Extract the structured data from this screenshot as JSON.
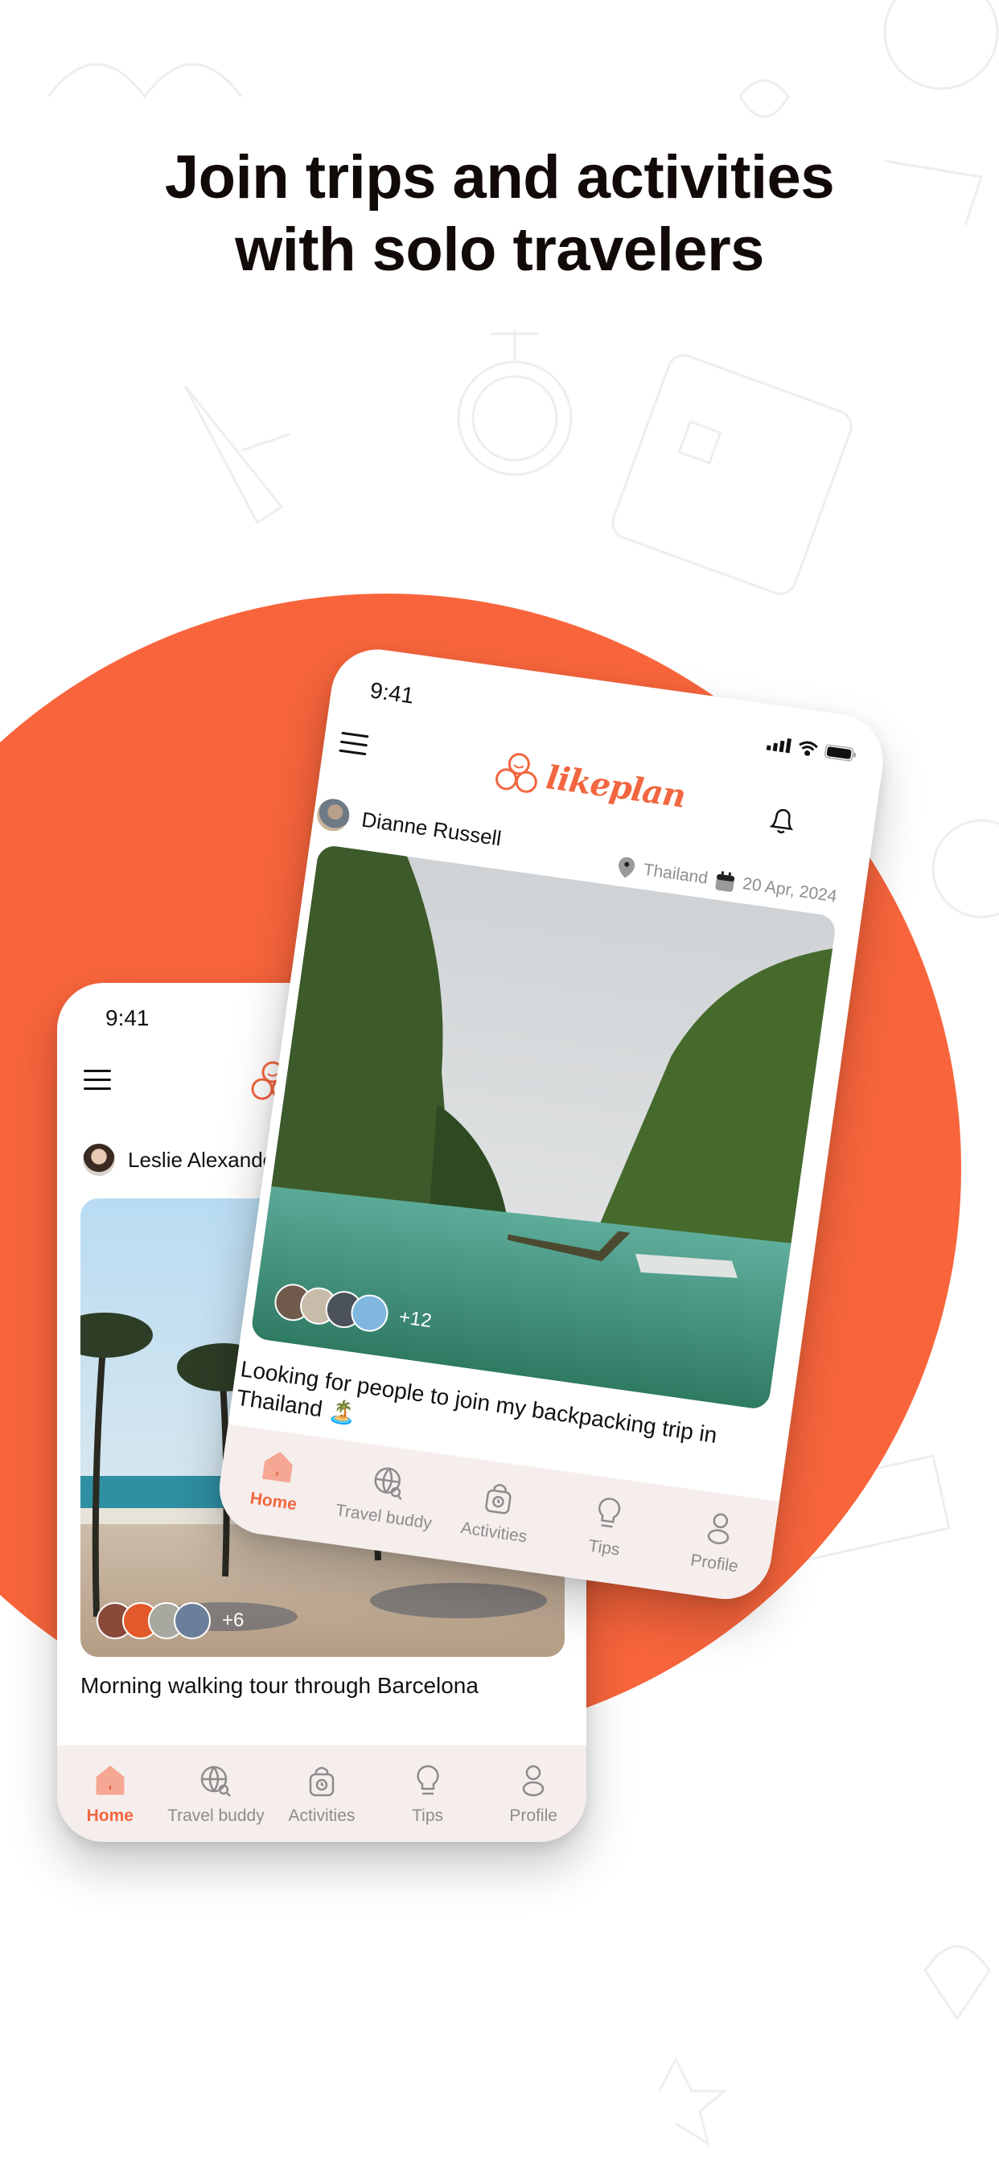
{
  "headline": {
    "line1": "Join trips and activities",
    "line2": "with solo travelers"
  },
  "colors": {
    "brand_orange": "#f8653c",
    "logo_orange": "#f26640",
    "tabbar_bg": "#f5eeec",
    "inactive_tab": "#8c8c8c"
  },
  "app": {
    "logo_text": "likeplan",
    "status_time": "9:41"
  },
  "phone_left": {
    "status_time": "9:41",
    "author": "Leslie Alexander",
    "participants_more": "+6",
    "post_title": "Morning walking tour through Barcelona",
    "image_alt": "Barcelona beach promenade with palm trees"
  },
  "phone_right": {
    "status_time": "9:41",
    "author": "Dianne Russell",
    "location": "Thailand",
    "date": "20 Apr, 2024",
    "participants_more": "+12",
    "post_title": "Looking for people to join my backpacking trip in Thailand 🏝️",
    "image_alt": "Longtail boats between limestone cliffs in Thailand"
  },
  "tabs": [
    {
      "label": "Home",
      "icon": "home-icon",
      "active": true
    },
    {
      "label": "Travel buddy",
      "icon": "globe-search-icon",
      "active": false
    },
    {
      "label": "Activities",
      "icon": "backpack-icon",
      "active": false
    },
    {
      "label": "Tips",
      "icon": "lightbulb-icon",
      "active": false
    },
    {
      "label": "Profile",
      "icon": "profile-icon",
      "active": false
    }
  ]
}
